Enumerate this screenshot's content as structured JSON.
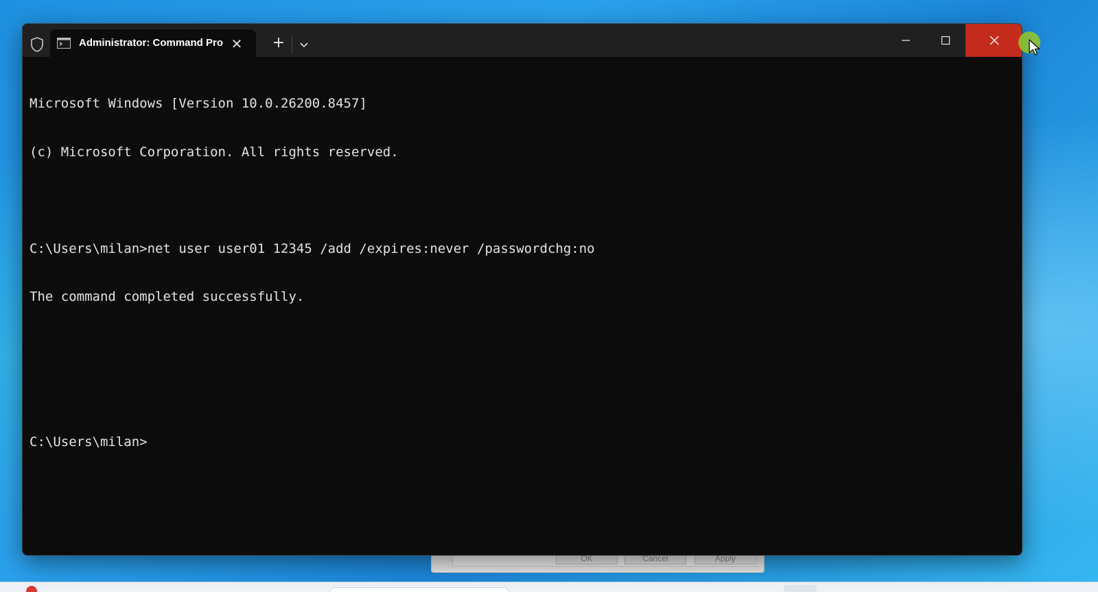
{
  "window": {
    "tab_title": "Administrator: Command Pro",
    "new_tab_symbol": "+",
    "tab_close_symbol": "✕",
    "accent_close_color": "#c42b1c",
    "titlebar_color": "#202020",
    "console_background": "#0c0c0c"
  },
  "console": {
    "lines": [
      "Microsoft Windows [Version 10.0.26200.8457]",
      "(c) Microsoft Corporation. All rights reserved.",
      "",
      "C:\\Users\\milan>net user user01 12345 /add /expires:never /passwordchg:no",
      "The command completed successfully.",
      "",
      "",
      "C:\\Users\\milan>"
    ]
  },
  "background_dialog": {
    "ok_label": "OK",
    "cancel_label": "Cancel",
    "apply_label": "Apply"
  },
  "icons": {
    "shield": "shield-icon",
    "terminal": "terminal-icon",
    "close": "close-icon",
    "add": "add-icon",
    "chevron": "chevron-down-icon",
    "minimize": "minimize-icon",
    "maximize": "maximize-icon",
    "cursor": "mouse-cursor-icon"
  }
}
